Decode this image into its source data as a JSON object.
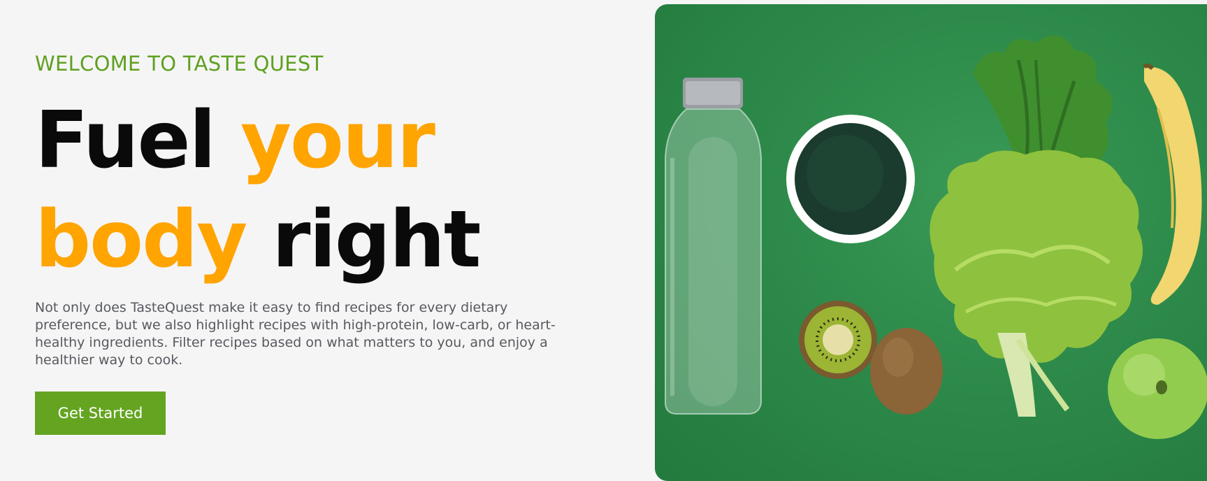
{
  "hero": {
    "eyebrow": "WELCOME TO TASTE QUEST",
    "headline": {
      "word1": "Fuel",
      "word2": "your",
      "word3": "body",
      "word4": "right"
    },
    "description": "Not only does TasteQuest make it easy to find recipes for every dietary preference, but we also highlight recipes with high-protein, low-carb, or heart-healthy ingredients. Filter recipes based on what matters to you, and enjoy a healthier way to cook.",
    "cta_label": "Get Started"
  },
  "colors": {
    "accent_green": "#64a421",
    "accent_orange": "#ffa400",
    "background": "#f5f5f5",
    "photo_background": "#2d8a4a"
  }
}
